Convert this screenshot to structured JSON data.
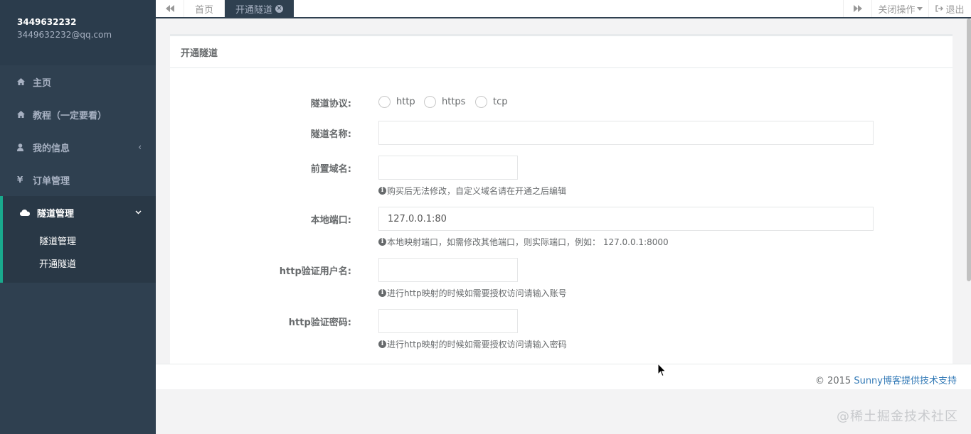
{
  "user": {
    "name": "3449632232",
    "email": "3449632232@qq.com"
  },
  "sidebar": {
    "items": [
      {
        "label": "主页",
        "icon": "home-icon"
      },
      {
        "label": "教程（一定要看）",
        "icon": "home-icon"
      },
      {
        "label": "我的信息",
        "icon": "user-icon",
        "arrow": "‹"
      },
      {
        "label": "订单管理",
        "icon": "yen-icon"
      },
      {
        "label": "隧道管理",
        "icon": "cloud-icon",
        "arrow": "⌄",
        "active": true
      }
    ],
    "sub_items": [
      {
        "label": "隧道管理"
      },
      {
        "label": "开通隧道"
      }
    ]
  },
  "tabs": {
    "home": "首页",
    "active": "开通隧道",
    "close_ops": "关闭操作",
    "exit": "退出"
  },
  "panel": {
    "title": "开通隧道"
  },
  "form": {
    "protocol": {
      "label": "隧道协议:",
      "options": [
        "http",
        "https",
        "tcp"
      ]
    },
    "tunnel_name": {
      "label": "隧道名称:",
      "value": ""
    },
    "subdomain": {
      "label": "前置域名:",
      "value": "",
      "help": "购买后无法修改，自定义域名请在开通之后编辑"
    },
    "local_port": {
      "label": "本地端口:",
      "value": "127.0.0.1:80",
      "help": "本地映射端口，如需修改其他端口，则实际端口，例如： 127.0.0.1:8000"
    },
    "http_user": {
      "label": "http验证用户名:",
      "value": "",
      "help": "进行http映射的时候如需要授权访问请输入账号"
    },
    "http_pass": {
      "label": "http验证密码:",
      "value": "",
      "help": "进行http映射的时候如需要授权访问请输入密码"
    }
  },
  "footer": {
    "prefix": "© 2015 ",
    "link": "Sunny博客提供技术支持"
  },
  "watermark": "@稀土掘金技术社区",
  "colors": {
    "sidebar_bg": "#2f4050",
    "accent": "#19aa8d",
    "link": "#337ab7"
  }
}
